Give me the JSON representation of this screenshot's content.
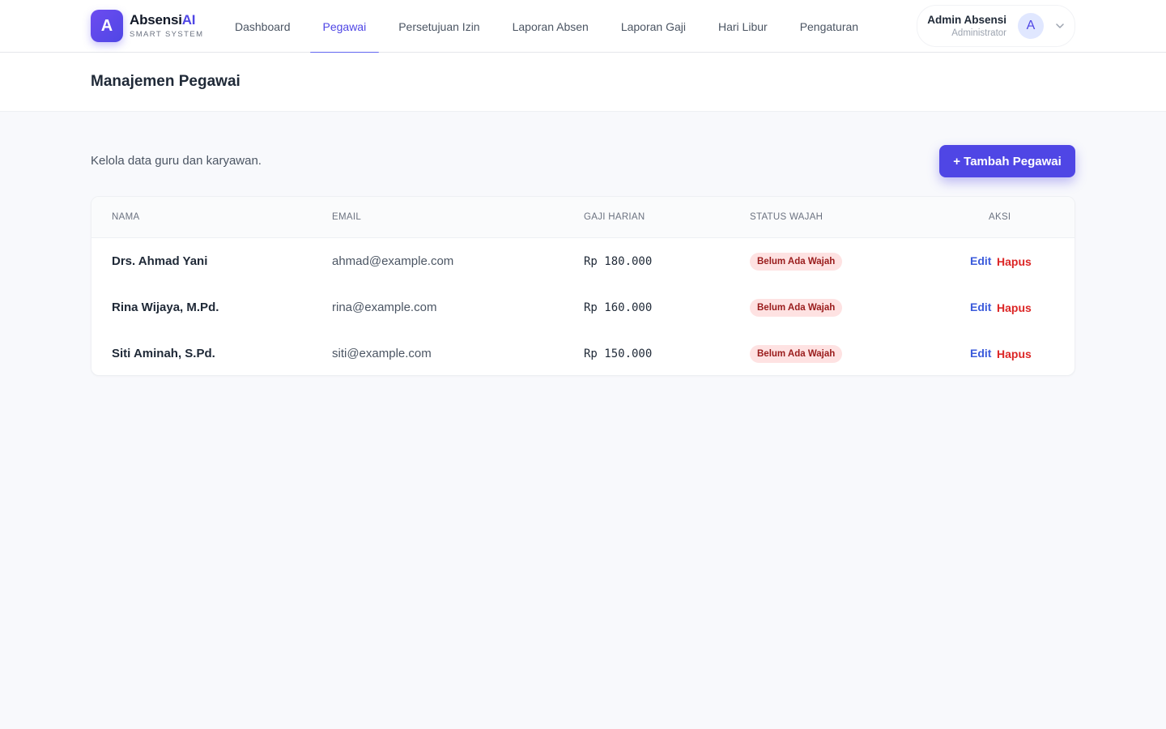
{
  "brand": {
    "initial": "A",
    "name": "Absensi",
    "name_accent": "AI",
    "subtitle": "SMART SYSTEM"
  },
  "nav": {
    "items": [
      {
        "label": "Dashboard",
        "active": false
      },
      {
        "label": "Pegawai",
        "active": true
      },
      {
        "label": "Persetujuan Izin",
        "active": false
      },
      {
        "label": "Laporan Absen",
        "active": false
      },
      {
        "label": "Laporan Gaji",
        "active": false
      },
      {
        "label": "Hari Libur",
        "active": false
      },
      {
        "label": "Pengaturan",
        "active": false
      }
    ]
  },
  "user": {
    "name": "Admin Absensi",
    "role": "Administrator",
    "avatar_initial": "A"
  },
  "page": {
    "title": "Manajemen Pegawai",
    "subtitle": "Kelola data guru dan karyawan.",
    "add_button": "+ Tambah Pegawai"
  },
  "table": {
    "headers": {
      "name": "NAMA",
      "email": "EMAIL",
      "gaji": "GAJI HARIAN",
      "status": "STATUS WAJAH",
      "aksi": "AKSI"
    },
    "rows": [
      {
        "name": "Drs. Ahmad Yani",
        "email": "ahmad@example.com",
        "gaji": "Rp 180.000",
        "status": "Belum Ada Wajah",
        "edit": "Edit",
        "delete": "Hapus"
      },
      {
        "name": "Rina Wijaya, M.Pd.",
        "email": "rina@example.com",
        "gaji": "Rp 160.000",
        "status": "Belum Ada Wajah",
        "edit": "Edit",
        "delete": "Hapus"
      },
      {
        "name": "Siti Aminah, S.Pd.",
        "email": "siti@example.com",
        "gaji": "Rp 150.000",
        "status": "Belum Ada Wajah",
        "edit": "Edit",
        "delete": "Hapus"
      }
    ]
  },
  "colors": {
    "accent": "#4f46e5",
    "badge_bg": "#fee2e2",
    "badge_text": "#991b1b",
    "delete": "#dc2626",
    "edit": "#3b5bdb"
  },
  "icons": {
    "user_menu": "chevron-down-icon"
  }
}
